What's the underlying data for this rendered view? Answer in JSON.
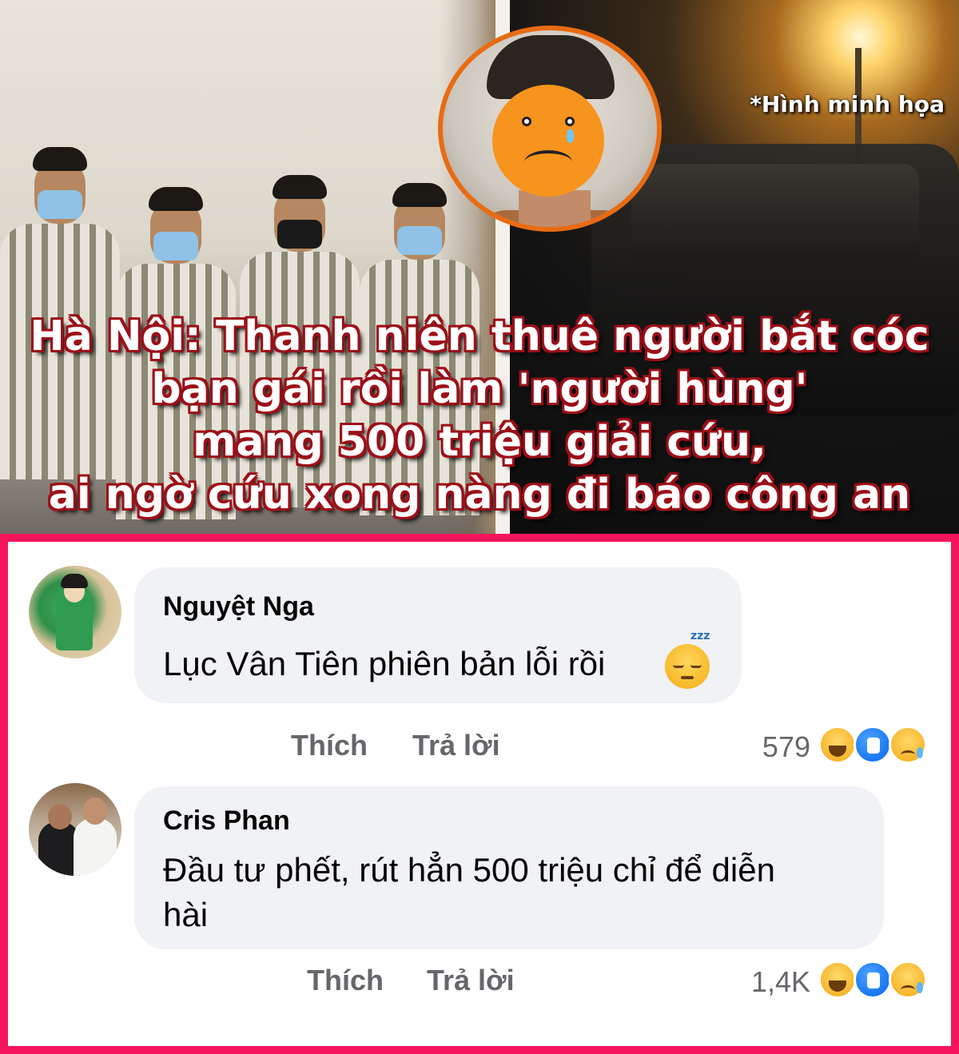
{
  "news_image": {
    "illustration_note": "*Hình minh họa",
    "headline_lines": [
      "Hà Nội: Thanh niên thuê người bắt cóc",
      "bạn gái rồi làm 'người hùng'",
      "mang 500 triệu giải cứu,",
      "ai ngờ cứu xong nàng đi báo công an"
    ]
  },
  "comments": [
    {
      "author": "Nguyệt Nga",
      "text": "Lục Vân Tiên phiên bản lỗi rồi",
      "text_emoji": "sleepy-face-icon",
      "like_label": "Thích",
      "reply_label": "Trả lời",
      "reaction_count": "579",
      "reactions": [
        "haha",
        "like",
        "sad"
      ]
    },
    {
      "author": "Cris Phan",
      "text_line1": "Đầu tư phết, rút hẳn 500 triệu chỉ để diễn",
      "text_line2": "hài",
      "like_label": "Thích",
      "reply_label": "Trả lời",
      "reaction_count": "1,4K",
      "reactions": [
        "haha",
        "like",
        "sad"
      ]
    }
  ],
  "colors": {
    "panel_border": "#f4155c",
    "headline_outline": "#9c0f18",
    "bubble": "#f0f2f5",
    "meta_text": "#65676b"
  }
}
